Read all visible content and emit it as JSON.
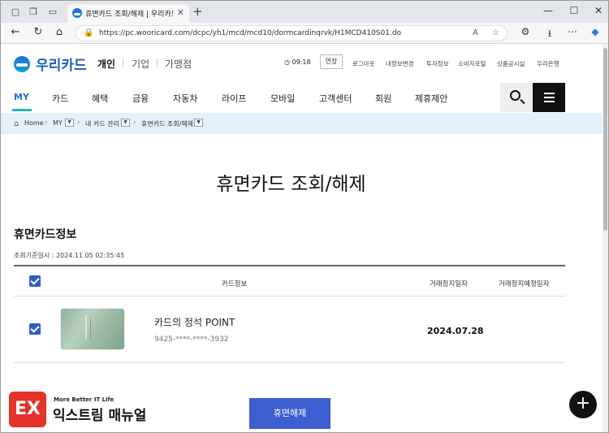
{
  "browser": {
    "tab_title": "휴면카드 조회/해제 | 우리카드(개",
    "url": "https://pc.wooricard.com/dcpc/yh1/mcd/mcd10/dormcardinqrvk/H1MCD410S01.do"
  },
  "header": {
    "logo": "우리카드",
    "segments": [
      "개인",
      "기업",
      "가맹점"
    ],
    "session_time": "09:18",
    "extend_label": "연장",
    "util_links": [
      "로그아웃",
      "내정보변경",
      "투자정보",
      "소비자포털",
      "상품공시실",
      "우리은행"
    ]
  },
  "gnb": {
    "items": [
      "MY",
      "카드",
      "혜택",
      "금융",
      "자동차",
      "라이프",
      "모바일",
      "고객센터",
      "회원",
      "제휴제안"
    ]
  },
  "breadcrumb": {
    "items": [
      "Home",
      "MY",
      "내 카드 관리",
      "휴면카드 조회/해제"
    ]
  },
  "content": {
    "page_title": "휴면카드 조회/해제",
    "section_title": "휴면카드정보",
    "inquiry_time": "조회기준일시 : 2024.11.05 02:35:45",
    "table_headers": [
      "카드정보",
      "거래정지일자",
      "거래정지예정일자"
    ],
    "rows": [
      {
        "card_name": "카드의 정석 POINT",
        "card_number": "9425-****-****-3932",
        "stop_date": "2024.07.28",
        "scheduled_stop_date": ""
      }
    ],
    "release_button": "휴면해제",
    "fab_label": "+"
  },
  "watermark": {
    "logo_text": "EX",
    "tagline": "More Better IT Life",
    "name": "익스트림 매뉴얼"
  },
  "colors": {
    "accent_blue": "#3c5ed1",
    "brand_blue": "#1b5fb8",
    "nav_active": "#1e6ed6",
    "underline_teal": "#2ab7a9",
    "breadcrumb_bg": "#e5f1fa"
  }
}
